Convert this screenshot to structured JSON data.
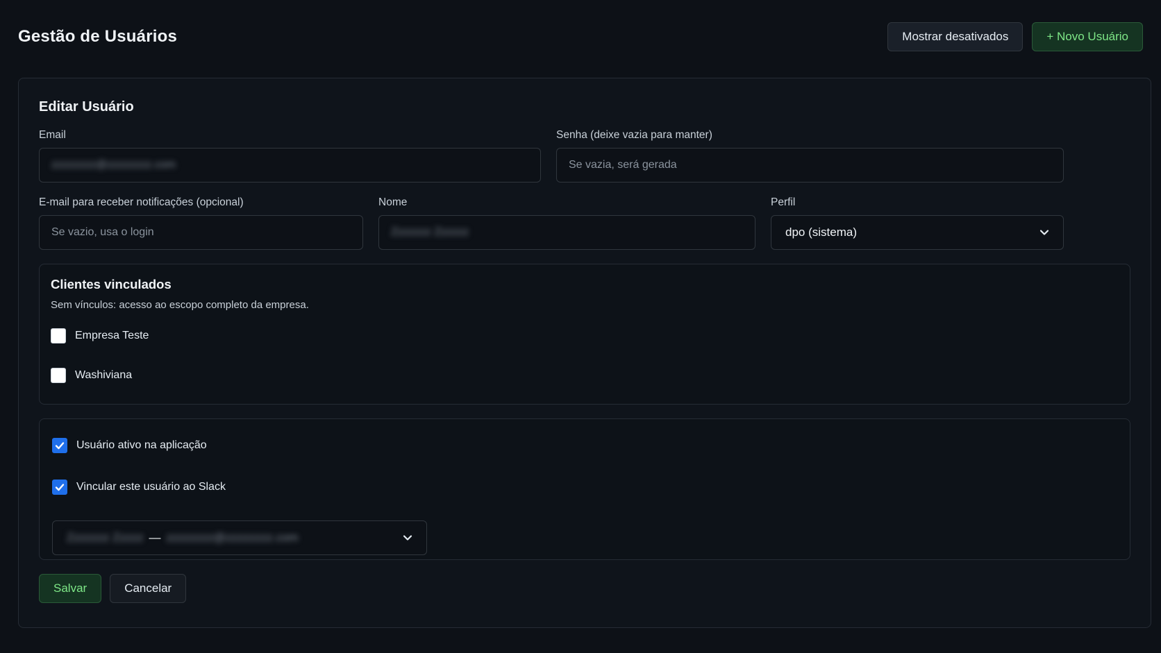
{
  "header": {
    "title": "Gestão de Usuários",
    "show_disabled_label": "Mostrar desativados",
    "new_user_label": "+ Novo Usuário"
  },
  "form": {
    "title": "Editar Usuário",
    "email": {
      "label": "Email",
      "value": "zzzzzzzz@zzzzzzzz.com"
    },
    "password": {
      "label": "Senha (deixe vazia para manter)",
      "placeholder": "Se vazia, será gerada"
    },
    "notify_email": {
      "label": "E-mail para receber notificações (opcional)",
      "placeholder": "Se vazio, usa o login"
    },
    "name": {
      "label": "Nome",
      "value": "Zzzzzzz Zzzzzz"
    },
    "profile": {
      "label": "Perfil",
      "selected": "dpo (sistema)"
    },
    "clients": {
      "title": "Clientes vinculados",
      "description": "Sem vínculos: acesso ao escopo completo da empresa.",
      "items": [
        {
          "label": "Empresa Teste",
          "checked": false
        },
        {
          "label": "Washiviana",
          "checked": false
        }
      ]
    },
    "options": {
      "active_label": "Usuário ativo na aplicação",
      "active_checked": true,
      "slack_label": "Vincular este usuário ao Slack",
      "slack_checked": true,
      "slack_user_company": "Zzzzzzz Zzzzz",
      "slack_separator": "—",
      "slack_user_email": "zzzzzzzz@zzzzzzzz.com"
    },
    "save_label": "Salvar",
    "cancel_label": "Cancelar"
  }
}
